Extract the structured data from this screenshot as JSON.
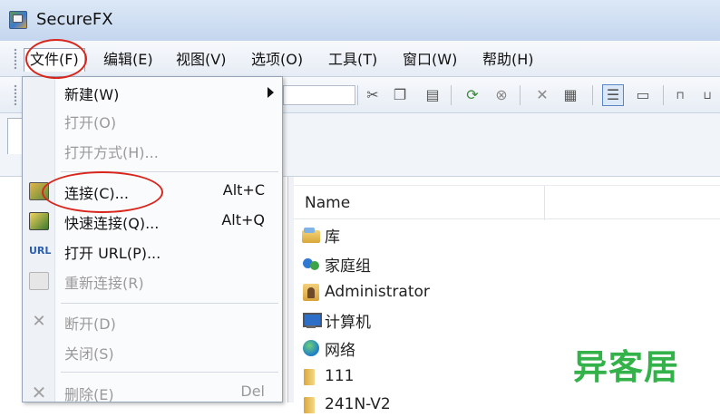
{
  "window": {
    "title": "SecureFX"
  },
  "menubar": {
    "items": [
      "文件(F)",
      "编辑(E)",
      "视图(V)",
      "选项(O)",
      "工具(T)",
      "窗口(W)",
      "帮助(H)"
    ]
  },
  "file_menu": {
    "items": [
      {
        "label": "新建(W)",
        "shortcut": "",
        "submenu": true,
        "enabled": true,
        "icon": ""
      },
      {
        "label": "打开(O)",
        "shortcut": "",
        "submenu": false,
        "enabled": false,
        "icon": ""
      },
      {
        "label": "打开方式(H)...",
        "shortcut": "",
        "submenu": false,
        "enabled": false,
        "icon": ""
      },
      {
        "label": "连接(C)...",
        "shortcut": "Alt+C",
        "submenu": false,
        "enabled": true,
        "icon": "connect-icon"
      },
      {
        "label": "快速连接(Q)...",
        "shortcut": "Alt+Q",
        "submenu": false,
        "enabled": true,
        "icon": "quick-connect-icon"
      },
      {
        "label": "打开 URL(P)...",
        "shortcut": "",
        "submenu": false,
        "enabled": true,
        "icon": "url-icon"
      },
      {
        "label": "重新连接(R)",
        "shortcut": "",
        "submenu": false,
        "enabled": false,
        "icon": "reconnect-icon"
      },
      {
        "label": "断开(D)",
        "shortcut": "",
        "submenu": false,
        "enabled": false,
        "icon": "disconnect-icon"
      },
      {
        "label": "关闭(S)",
        "shortcut": "",
        "submenu": false,
        "enabled": false,
        "icon": ""
      },
      {
        "label": "删除(E)",
        "shortcut": "Del",
        "submenu": false,
        "enabled": false,
        "icon": "delete-icon"
      }
    ],
    "url_icon_text": "URL"
  },
  "file_list": {
    "column_name": "Name",
    "items": [
      {
        "name": "库",
        "icon": "library-icon"
      },
      {
        "name": "家庭组",
        "icon": "homegroup-icon"
      },
      {
        "name": "Administrator",
        "icon": "user-folder-icon"
      },
      {
        "name": "计算机",
        "icon": "computer-icon"
      },
      {
        "name": "网络",
        "icon": "network-icon"
      },
      {
        "name": "111",
        "icon": "folder-icon"
      },
      {
        "name": "241N-V2",
        "icon": "folder-icon"
      }
    ]
  },
  "toolbar": {
    "icons": [
      "cut-icon",
      "copy-icon",
      "paste-icon",
      "refresh-icon",
      "stop-icon",
      "delete-icon",
      "properties-icon",
      "view-details-icon",
      "view-other-icon",
      "sort-icon",
      "sort-alt-icon"
    ]
  },
  "watermark": "异客居",
  "colors": {
    "annotation": "#d9261c",
    "watermark": "#33b24a",
    "title_bar": "#c4d6ee"
  }
}
